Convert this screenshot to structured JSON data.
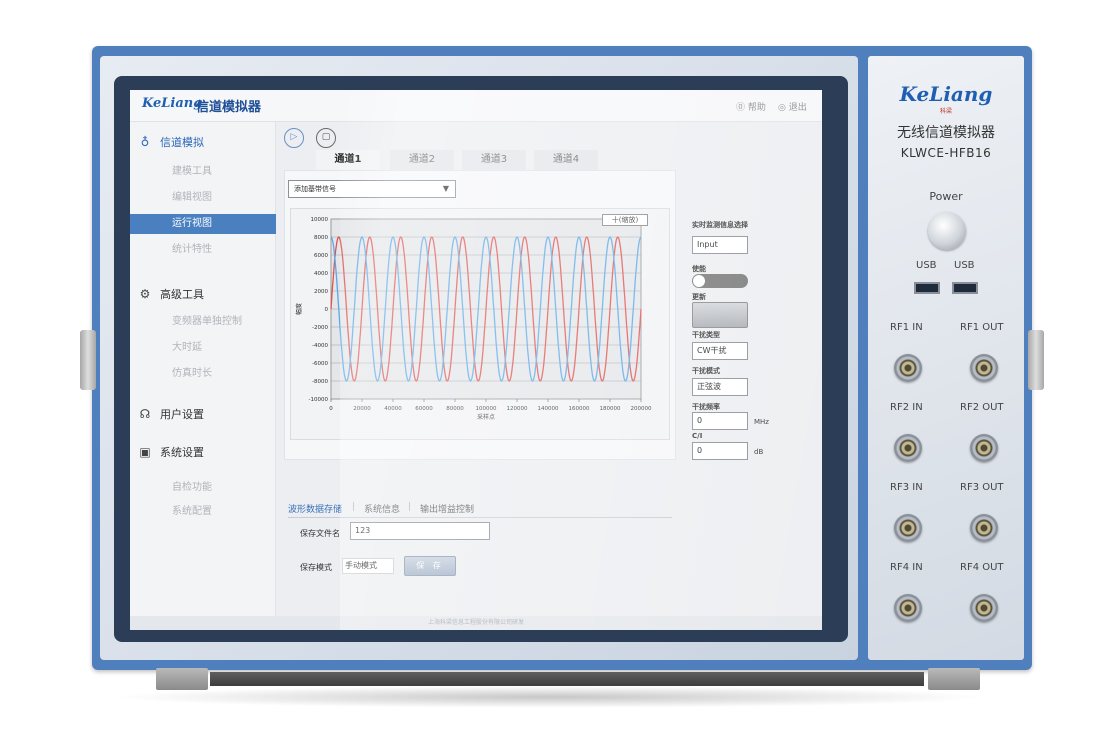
{
  "app": {
    "logo": "KeLiang",
    "title": "信道模拟器",
    "help": "帮助",
    "exit": "退出",
    "footer": "上海科梁信息工程股份有限公司研发"
  },
  "sidebar": {
    "sections": [
      {
        "label": "信道模拟",
        "icon": "channel-icon",
        "items": [
          "建模工具",
          "编辑视图",
          "运行视图",
          "统计特性"
        ]
      },
      {
        "label": "高级工具",
        "icon": "gear-icon",
        "items": [
          "变频器单独控制",
          "大时延",
          "仿真时长"
        ]
      },
      {
        "label": "用户设置",
        "icon": "users-icon",
        "items": []
      },
      {
        "label": "系统设置",
        "icon": "monitor-icon",
        "items": [
          "自检功能",
          "系统配置"
        ]
      }
    ],
    "active_item": "运行视图"
  },
  "main": {
    "tabs": [
      "通道1",
      "通道2",
      "通道3",
      "通道4"
    ],
    "active_tab": "通道1",
    "signal_select": "添加基带信号",
    "zoom_button": "十(缩放)",
    "lower_tabs": [
      "波形数据存储",
      "系统信息",
      "输出增益控制"
    ],
    "active_lower_tab": "波形数据存储",
    "save_filename_label": "保存文件名",
    "save_filename_value": "123",
    "save_mode_label": "保存模式",
    "save_mode_value": "手动模式",
    "save_button": "保 存"
  },
  "right_panel": {
    "monitor_label": "实时监测信息选择",
    "monitor_value": "Input",
    "enable_label": "使能",
    "update_label": "更新",
    "interference_type_label": "干扰类型",
    "interference_type_value": "CW干扰",
    "interference_mode_label": "干扰模式",
    "interference_mode_value": "正弦波",
    "interference_freq_label": "干扰频率",
    "interference_freq_value": "0",
    "interference_freq_unit": "MHz",
    "ci_label": "C/I",
    "ci_value": "0",
    "ci_unit": "dB"
  },
  "device": {
    "logo": "KeLiang",
    "logo_sub": "科梁",
    "title": "无线信道模拟器",
    "model": "KLWCE-HFB16",
    "power_label": "Power",
    "usb_labels": [
      "USB",
      "USB"
    ],
    "rf_ports": [
      [
        "RF1 IN",
        "RF1 OUT"
      ],
      [
        "RF2 IN",
        "RF2 OUT"
      ],
      [
        "RF3 IN",
        "RF3 OUT"
      ],
      [
        "RF4 IN",
        "RF4 OUT"
      ]
    ]
  },
  "chart_data": {
    "type": "line",
    "title": "",
    "xlabel": "采样点",
    "ylabel": "幅度",
    "xlim": [
      0,
      200000
    ],
    "ylim": [
      -10000,
      10000
    ],
    "xticks": [
      0,
      20000,
      40000,
      60000,
      80000,
      100000,
      120000,
      140000,
      160000,
      180000,
      200000
    ],
    "yticks": [
      10000,
      8000,
      6000,
      4000,
      2000,
      0,
      -2000,
      -4000,
      -6000,
      -8000,
      -10000
    ],
    "grid": true,
    "series": [
      {
        "color": "#e0524f",
        "amplitude": 8000,
        "cycles": 10,
        "phase_deg": 0
      },
      {
        "color": "#5aa7e6",
        "amplitude": 8000,
        "cycles": 10,
        "phase_deg": 90
      }
    ]
  }
}
